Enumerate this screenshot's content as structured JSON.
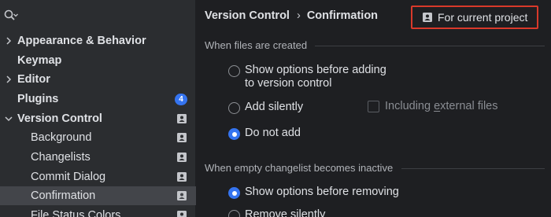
{
  "sidebar": {
    "items": [
      {
        "label": "Appearance & Behavior"
      },
      {
        "label": "Keymap"
      },
      {
        "label": "Editor"
      },
      {
        "label": "Plugins",
        "badge": "4"
      },
      {
        "label": "Version Control"
      },
      {
        "label": "Background"
      },
      {
        "label": "Changelists"
      },
      {
        "label": "Commit Dialog"
      },
      {
        "label": "Confirmation"
      },
      {
        "label": "File Status Colors"
      }
    ]
  },
  "header": {
    "crumb_parent": "Version Control",
    "crumb_separator": "›",
    "crumb_current": "Confirmation",
    "scope_label": "For current project"
  },
  "files_created": {
    "title": "When files are created",
    "options": [
      {
        "line1": "Show options before adding",
        "line2": "to version control",
        "checked": false
      },
      {
        "line1": "Add silently",
        "checked": false
      },
      {
        "line1": "Do not add",
        "checked": true
      }
    ],
    "include_external": {
      "prefix": "Including ",
      "underlined": "e",
      "rest": "xternal files",
      "checked": false
    }
  },
  "empty_changelist": {
    "title": "When empty changelist becomes inactive",
    "options": [
      {
        "line1": "Show options before removing",
        "checked": true
      },
      {
        "line1": "Remove silently",
        "checked": false
      }
    ]
  },
  "colors": {
    "accent": "#3574f0",
    "highlight_border": "#d9392a",
    "sidebar_bg": "#2b2d30",
    "panel_bg": "#1e1f22"
  }
}
